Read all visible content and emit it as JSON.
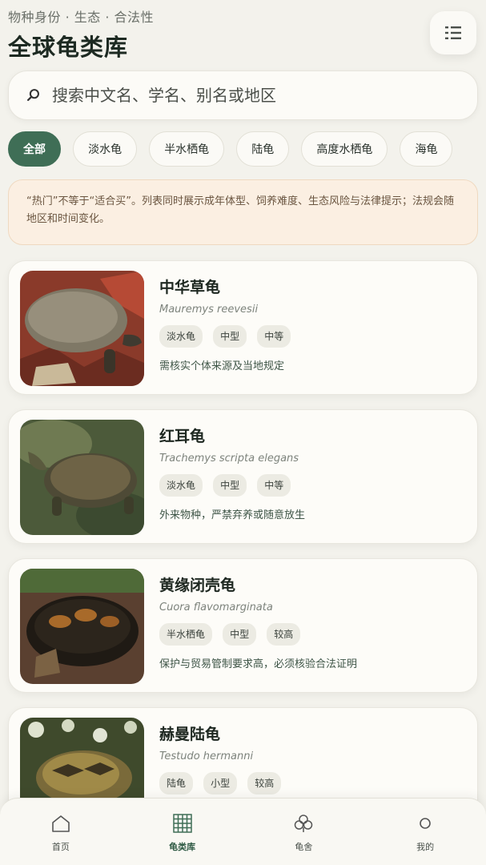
{
  "header": {
    "subtitle": "物种身份 · 生态 · 合法性",
    "title": "全球龟类库"
  },
  "search": {
    "placeholder": "搜索中文名、学名、别名或地区"
  },
  "filters": [
    "全部",
    "淡水龟",
    "半水栖龟",
    "陆龟",
    "高度水栖龟",
    "海龟"
  ],
  "active_filter": "全部",
  "notice": "“热门”不等于“适合买”。列表同时展示成年体型、饲养难度、生态风险与法律提示；法规会随地区和时间变化。",
  "species": [
    {
      "name": "中华草龟",
      "scientific": "Mauremys reevesii",
      "tags": [
        "淡水龟",
        "中型",
        "中等"
      ],
      "note": "需核实个体来源及当地规定"
    },
    {
      "name": "红耳龟",
      "scientific": "Trachemys scripta elegans",
      "tags": [
        "淡水龟",
        "中型",
        "中等"
      ],
      "note": "外来物种，严禁弃养或随意放生"
    },
    {
      "name": "黄缘闭壳龟",
      "scientific": "Cuora flavomarginata",
      "tags": [
        "半水栖龟",
        "中型",
        "较高"
      ],
      "note": "保护与贸易管制要求高，必须核验合法证明"
    },
    {
      "name": "赫曼陆龟",
      "scientific": "Testudo hermanni",
      "tags": [
        "陆龟",
        "小型",
        "较高"
      ],
      "note": ""
    }
  ],
  "tabbar": [
    {
      "label": "首页",
      "icon": "home-icon"
    },
    {
      "label": "龟类库",
      "icon": "grid-icon"
    },
    {
      "label": "龟舍",
      "icon": "clover-icon"
    },
    {
      "label": "我的",
      "icon": "profile-icon"
    }
  ],
  "active_tab": "龟类库"
}
